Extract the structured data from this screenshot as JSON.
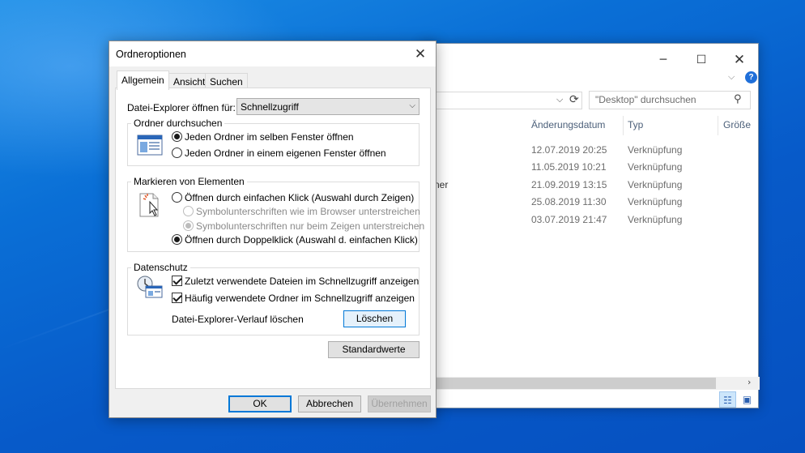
{
  "explorer": {
    "window_controls": {
      "minimize": "─",
      "maximize": "☐",
      "close": "✕"
    },
    "ribbon_chevron": "⌵",
    "help": "?",
    "search_placeholder": "\"Desktop\" durchsuchen",
    "columns": {
      "date": "Änderungsdatum",
      "type": "Typ",
      "size": "Größe"
    },
    "rows": [
      {
        "name_fragment": "",
        "date": "12.07.2019 20:25",
        "type": "Verknüpfung"
      },
      {
        "name_fragment": "",
        "date": "11.05.2019 10:21",
        "type": "Verknüpfung"
      },
      {
        "name_fragment": "ner",
        "date": "21.09.2019 13:15",
        "type": "Verknüpfung"
      },
      {
        "name_fragment": "",
        "date": "25.08.2019 11:30",
        "type": "Verknüpfung"
      },
      {
        "name_fragment": "",
        "date": "03.07.2019 21:47",
        "type": "Verknüpfung"
      }
    ]
  },
  "dialog": {
    "title": "Ordneroptionen",
    "close": "✕",
    "tabs": [
      {
        "label": "Allgemein",
        "active": true
      },
      {
        "label": "Ansicht",
        "active": false
      },
      {
        "label": "Suchen",
        "active": false
      }
    ],
    "open_for": {
      "label": "Datei-Explorer öffnen für:",
      "value": "Schnellzugriff"
    },
    "browse": {
      "title": "Ordner durchsuchen",
      "options": [
        {
          "label": "Jeden Ordner im selben Fenster öffnen",
          "checked": true
        },
        {
          "label": "Jeden Ordner in einem eigenen Fenster öffnen",
          "checked": false
        }
      ]
    },
    "click": {
      "title": "Markieren von Elementen",
      "single": "Öffnen durch einfachen Klick (Auswahl durch Zeigen)",
      "underline_browser": "Symbolunterschriften wie im Browser unterstreichen",
      "underline_hover": "Symbolunterschriften nur beim Zeigen unterstreichen",
      "double": "Öffnen durch Doppelklick (Auswahl d. einfachen Klick)",
      "selected": "double"
    },
    "privacy": {
      "title": "Datenschutz",
      "recent_files": {
        "label": "Zuletzt verwendete Dateien im Schnellzugriff anzeigen",
        "checked": true
      },
      "frequent_folders": {
        "label": "Häufig verwendete Ordner im Schnellzugriff anzeigen",
        "checked": true
      },
      "clear_label": "Datei-Explorer-Verlauf löschen",
      "clear_button": "Löschen"
    },
    "restore_button": "Standardwerte",
    "ok_button": "OK",
    "cancel_button": "Abbrechen",
    "apply_button": "Übernehmen"
  }
}
